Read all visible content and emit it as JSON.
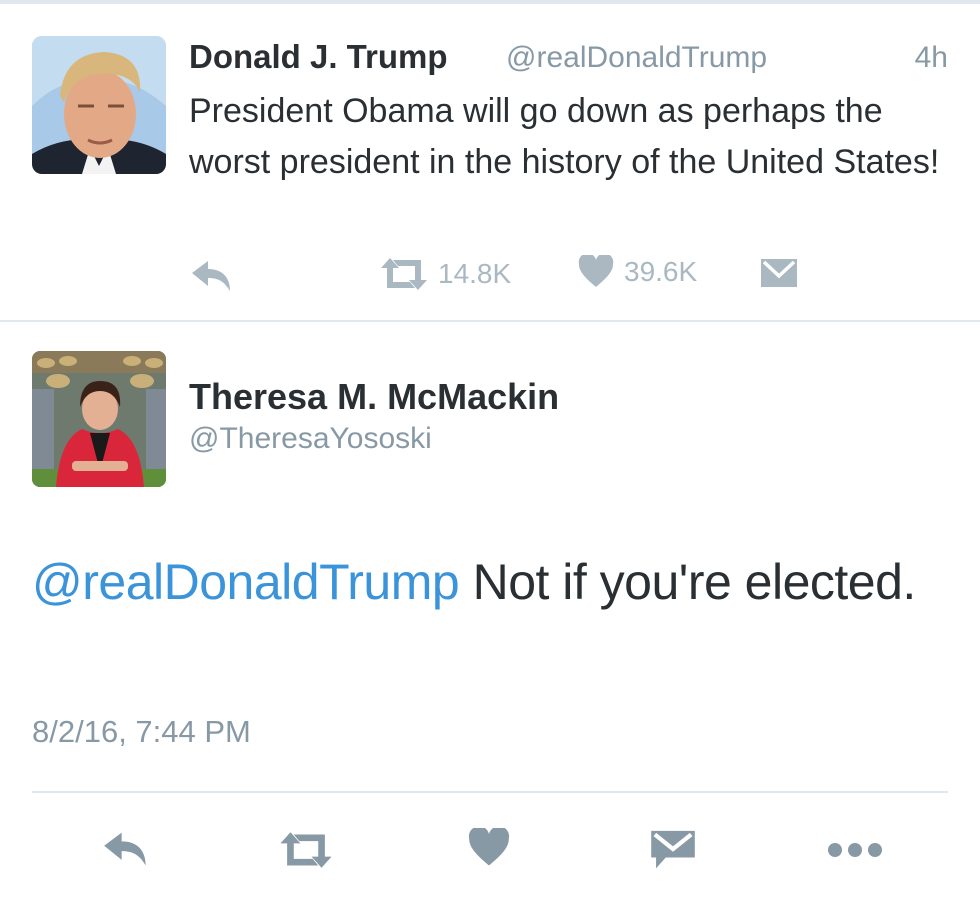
{
  "tweet": {
    "author_name": "Donald J. Trump",
    "author_handle": "@realDonaldTrump",
    "time_ago": "4h",
    "text": "President Obama will go down as perhaps the worst president in the history of the United States!",
    "retweet_count": "14.8K",
    "like_count": "39.6K"
  },
  "reply": {
    "author_name": "Theresa M. McMackin",
    "author_handle": "@TheresaYososki",
    "mention": "@realDonaldTrump",
    "text": " Not if you're elected.",
    "timestamp": "8/2/16, 7:44 PM"
  },
  "icons": [
    "reply-icon",
    "retweet-icon",
    "like-icon",
    "message-icon",
    "more-icon"
  ],
  "colors": {
    "mention": "#3b94d9",
    "meta_gray": "#8899a6",
    "action_gray": "#aab8c2",
    "divider": "#e1e8ed"
  }
}
